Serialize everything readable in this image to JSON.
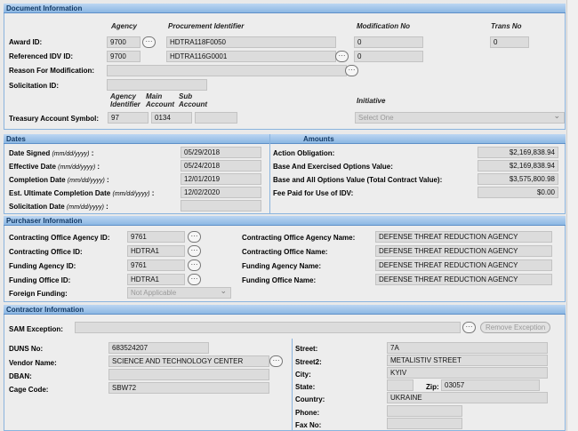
{
  "doc": {
    "title": "Document Information",
    "cols": {
      "agency": "Agency",
      "proc_id": "Procurement Identifier",
      "mod_no": "Modification No",
      "trans_no": "Trans No"
    },
    "award_id_label": "Award ID:",
    "award_agency": "9700",
    "award_proc": "HDTRA118F0050",
    "award_mod": "0",
    "award_trans": "0",
    "ref_idv_label": "Referenced IDV ID:",
    "ref_agency": "9700",
    "ref_proc": "HDTRA116G0001",
    "ref_mod": "0",
    "reason_label": "Reason For Modification:",
    "solicitation_label": "Solicitation ID:",
    "tas_cols": {
      "agency": "Agency",
      "agency2": "Identifier",
      "main": "Main",
      "main2": "Account",
      "sub": "Sub",
      "sub2": "Account"
    },
    "initiative_label": "Initiative",
    "tas_label": "Treasury Account Symbol:",
    "tas_agency": "97",
    "tas_main": "0134",
    "initiative_select": "Select One"
  },
  "dates": {
    "title": "Dates",
    "signed_label": "Date Signed",
    "signed_value": "05/29/2018",
    "effective_label": "Effective Date",
    "effective_value": "05/24/2018",
    "completion_label": "Completion Date",
    "completion_value": "12/01/2019",
    "ultimate_label": "Est. Ultimate Completion Date",
    "ultimate_value": "12/02/2020",
    "solicitation_label": "Solicitation Date",
    "fmt": "(mm/dd/yyyy)"
  },
  "amounts": {
    "title": "Amounts",
    "obligation_label": "Action Obligation:",
    "obligation_value": "$2,169,838.94",
    "base_ex_label": "Base And Exercised Options Value:",
    "base_ex_value": "$2,169,838.94",
    "base_all_label": "Base and All Options Value (Total Contract Value):",
    "base_all_value": "$3,575,800.98",
    "fee_label": "Fee Paid for Use of IDV:",
    "fee_value": "$0.00"
  },
  "purchaser": {
    "title": "Purchaser Information",
    "coa_id_label": "Contracting Office Agency ID:",
    "coa_id": "9761",
    "co_id_label": "Contracting Office ID:",
    "co_id": "HDTRA1",
    "fa_id_label": "Funding Agency ID:",
    "fa_id": "9761",
    "fo_id_label": "Funding Office ID:",
    "fo_id": "HDTRA1",
    "foreign_label": "Foreign Funding:",
    "foreign_value": "Not Applicable",
    "coa_name_label": "Contracting Office Agency Name:",
    "coa_name": "DEFENSE THREAT REDUCTION AGENCY",
    "co_name_label": "Contracting Office Name:",
    "co_name": "DEFENSE THREAT REDUCTION AGENCY",
    "fa_name_label": "Funding Agency Name:",
    "fa_name": "DEFENSE THREAT REDUCTION AGENCY",
    "fo_name_label": "Funding Office Name:",
    "fo_name": "DEFENSE THREAT REDUCTION AGENCY"
  },
  "contractor": {
    "title": "Contractor Information",
    "sam_label": "SAM Exception:",
    "remove_label": "Remove Exception",
    "duns_label": "DUNS No:",
    "duns": "683524207",
    "vendor_label": "Vendor Name:",
    "vendor": "SCIENCE AND TECHNOLOGY CENTER",
    "dban_label": "DBAN:",
    "cage_label": "Cage Code:",
    "cage": "SBW72",
    "street_label": "Street:",
    "street": "7A",
    "street2_label": "Street2:",
    "street2": "METALISTIV STREET",
    "city_label": "City:",
    "city": "KYIV",
    "state_label": "State:",
    "zip_label": "Zip:",
    "zip": "03057",
    "country_label": "Country:",
    "country": "UKRAINE",
    "phone_label": "Phone:",
    "fax_label": "Fax No:"
  },
  "icons": {
    "lookup": "ellipsis-lookup-icon"
  }
}
